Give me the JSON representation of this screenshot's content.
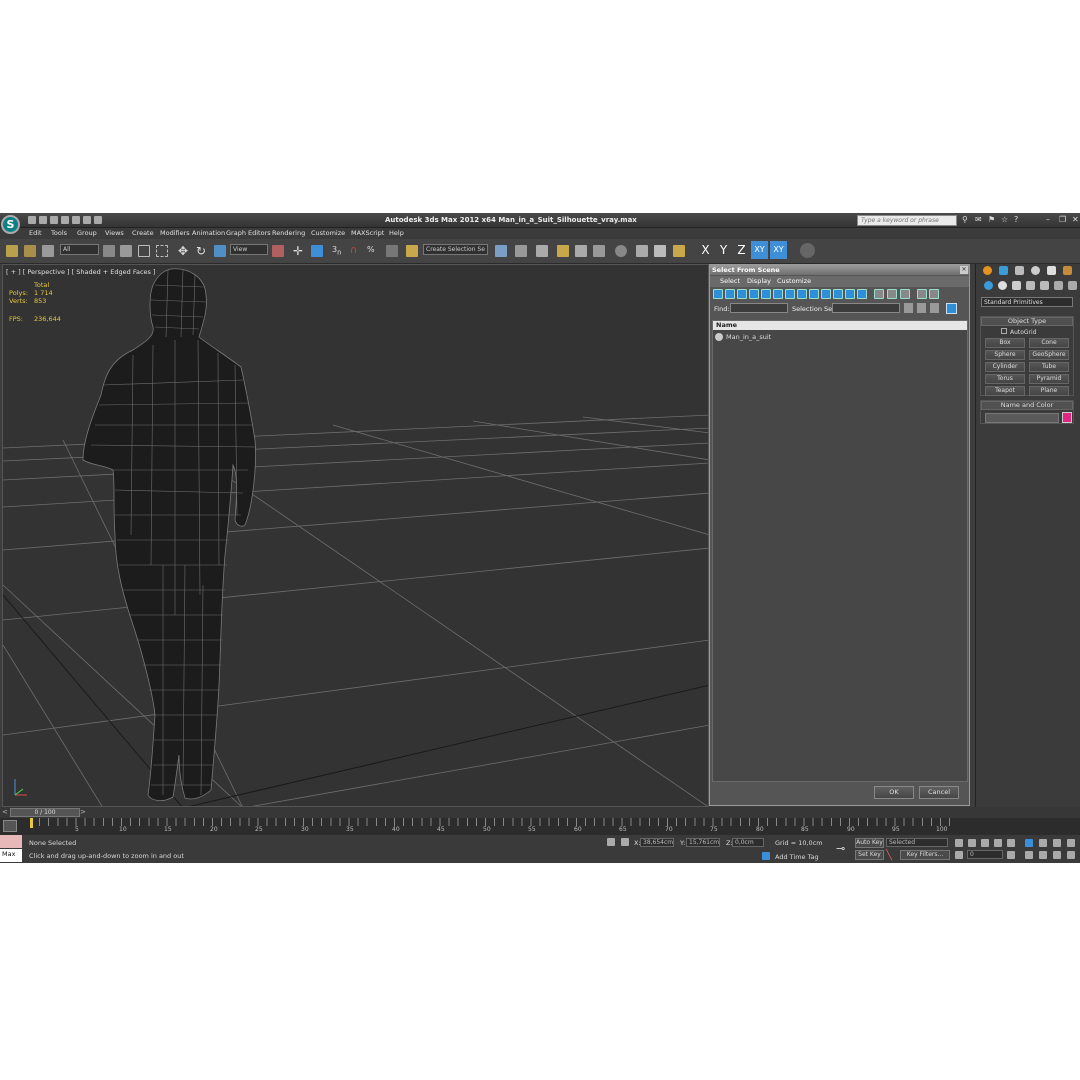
{
  "app": {
    "title": "Autodesk 3ds Max  2012 x64     Man_in_a_Suit_Silhouette_vray.max",
    "search_placeholder": "Type a keyword or phrase",
    "menus": [
      "Edit",
      "Tools",
      "Group",
      "Views",
      "Create",
      "Modifiers",
      "Animation",
      "Graph Editors",
      "Rendering",
      "Customize",
      "MAXScript",
      "Help"
    ]
  },
  "toolbar": {
    "selection_filter": "All",
    "ref_coord": "View",
    "named_selection": "Create Selection Se",
    "axes": [
      "X",
      "Y",
      "Z",
      "XY",
      "XY"
    ]
  },
  "viewport": {
    "label": "[ + ] [ Perspective ] [ Shaded + Edged Faces ]",
    "stats": {
      "total_label": "Total",
      "polys_label": "Polys:",
      "polys_value": "1 714",
      "verts_label": "Verts:",
      "verts_value": "853",
      "fps_label": "FPS:",
      "fps_value": "236,644"
    }
  },
  "dialog": {
    "title": "Select From Scene",
    "menus": [
      "Select",
      "Display",
      "Customize"
    ],
    "find_label": "Find:",
    "selection_set_label": "Selection Set:",
    "list_header": "Name",
    "items": [
      "Man_in_a_suit"
    ],
    "ok": "OK",
    "cancel": "Cancel"
  },
  "command_panel": {
    "category": "Standard Primitives",
    "object_type_header": "Object Type",
    "autogrid": "AutoGrid",
    "primitives": [
      "Box",
      "Cone",
      "Sphere",
      "GeoSphere",
      "Cylinder",
      "Tube",
      "Torus",
      "Pyramid",
      "Teapot",
      "Plane"
    ],
    "name_color_header": "Name and Color",
    "color": "#e0267f"
  },
  "timeline": {
    "frame_counter": "0 / 100",
    "ticks": [
      "5",
      "10",
      "15",
      "20",
      "25",
      "30",
      "35",
      "40",
      "45",
      "50",
      "55",
      "60",
      "65",
      "70",
      "75",
      "80",
      "85",
      "90",
      "95",
      "100"
    ]
  },
  "status": {
    "maxscript": "Max",
    "selection": "None Selected",
    "prompt": "Click and drag up-and-down to zoom in and out",
    "x_label": "X:",
    "x_value": "38,654cm",
    "y_label": "Y:",
    "y_value": "15,761cm",
    "z_label": "Z:",
    "z_value": "0,0cm",
    "grid": "Grid = 10,0cm",
    "add_time_tag": "Add Time Tag",
    "auto_key": "Auto Key",
    "set_key": "Set Key",
    "selected": "Selected",
    "key_filters": "Key Filters...",
    "frame": "0"
  }
}
